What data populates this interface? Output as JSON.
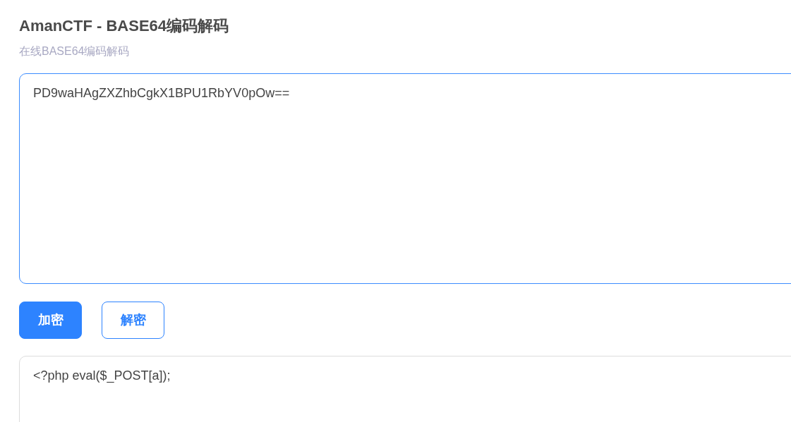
{
  "header": {
    "title": "AmanCTF - BASE64编码解码",
    "subtitle": "在线BASE64编码解码"
  },
  "input": {
    "value": "PD9waHAgZXZhbCgkX1BPU1RbYV0pOw==",
    "focused": true
  },
  "buttons": [
    {
      "label": "加密",
      "kind": "primary"
    },
    {
      "label": "解密",
      "kind": "outline"
    }
  ],
  "output": {
    "value": "<?php eval($_POST[a]);",
    "focused": false
  }
}
